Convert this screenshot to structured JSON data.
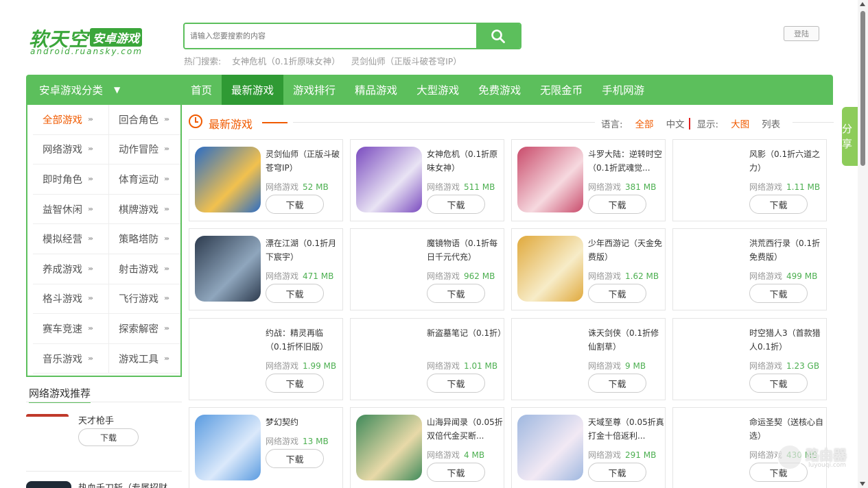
{
  "header": {
    "logo_main": "软天空",
    "logo_badge": "安卓游戏",
    "logo_sub": "android.ruansky.com",
    "search_placeholder": "请输入您要搜索的内容",
    "hot_label": "热门搜索:",
    "hot_items": [
      "女神危机（0.1折原味女神）",
      "灵剑仙师（正版斗破苍穹IP）"
    ],
    "login_label": "登陆"
  },
  "nav": {
    "category_label": "安卓游戏分类",
    "items": [
      "首页",
      "最新游戏",
      "游戏排行",
      "精品游戏",
      "大型游戏",
      "免费游戏",
      "无限金币",
      "手机网游"
    ],
    "active_index": 1
  },
  "categories": [
    "全部游戏",
    "回合角色",
    "网络游戏",
    "动作冒险",
    "即时角色",
    "体育运动",
    "益智休闲",
    "棋牌游戏",
    "模拟经营",
    "策略塔防",
    "养成游戏",
    "射击游戏",
    "格斗游戏",
    "飞行游戏",
    "赛车竞速",
    "探索解密",
    "音乐游戏",
    "游戏工具"
  ],
  "recommend": {
    "title": "网络游戏推荐",
    "items": [
      {
        "name": "天才枪手",
        "button": "下载"
      },
      {
        "name": "热血千刀斩（专属招财"
      }
    ]
  },
  "section": {
    "title": "最新游戏",
    "lang_label": "语言:",
    "lang_all": "全部",
    "lang_cn": "中文",
    "view_label": "显示:",
    "view_big": "大图",
    "view_list": "列表"
  },
  "games": [
    {
      "name": "灵剑仙师（正版斗破苍穹IP）",
      "category": "网络游戏",
      "size": "52 MB",
      "button": "下载",
      "icon": "game-icon-linjian",
      "colors": [
        "#2b6cc4",
        "#f2c14e"
      ]
    },
    {
      "name": "女神危机（0.1折原味女神）",
      "category": "网络游戏",
      "size": "511 MB",
      "button": "下载",
      "icon": "game-icon-nvshen",
      "colors": [
        "#7a4bbf",
        "#e9e4f4"
      ]
    },
    {
      "name": "斗罗大陆：逆转时空（0.1折武魂觉...",
      "category": "网络游戏",
      "size": "381 MB",
      "button": "下载",
      "icon": "game-icon-douluo",
      "colors": [
        "#c94b6b",
        "#f6d9df"
      ]
    },
    {
      "name": "风影（0.1折六道之力）",
      "category": "网络游戏",
      "size": "1.11 MB",
      "button": "下载",
      "icon": null,
      "colors": null
    },
    {
      "name": "漂在江湖（0.1折月下宸宇）",
      "category": "网络游戏",
      "size": "471 MB",
      "button": "下载",
      "icon": "game-icon-piaozai",
      "colors": [
        "#2d3b4e",
        "#8fa6bd"
      ]
    },
    {
      "name": "魔镜物语（0.1折每日千元代充）",
      "category": "网络游戏",
      "size": "962 MB",
      "button": "下载",
      "icon": null,
      "colors": null
    },
    {
      "name": "少年西游记（天金免费版）",
      "category": "网络游戏",
      "size": "1.62 MB",
      "button": "下载",
      "icon": "game-icon-xiyou",
      "colors": [
        "#e0a93c",
        "#f7ecc8"
      ]
    },
    {
      "name": "洪荒西行录（0.1折免费版）",
      "category": "网络游戏",
      "size": "499 MB",
      "button": "下载",
      "icon": null,
      "colors": null
    },
    {
      "name": "约战：精灵再临（0.1折怀旧版）",
      "category": "网络游戏",
      "size": "1.99 MB",
      "button": "下载",
      "icon": null,
      "colors": null
    },
    {
      "name": "新盗墓笔记（0.1折）",
      "category": "网络游戏",
      "size": "1.01 MB",
      "button": "下载",
      "icon": null,
      "colors": null
    },
    {
      "name": "诛天剑侠（0.1折修仙割草）",
      "category": "网络游戏",
      "size": "9 MB",
      "button": "下载",
      "icon": null,
      "colors": null
    },
    {
      "name": "时空猎人3（首款猎人0.1折）",
      "category": "网络游戏",
      "size": "1.23 GB",
      "button": "下载",
      "icon": null,
      "colors": null
    },
    {
      "name": "梦幻契约",
      "category": "网络游戏",
      "size": "13 MB",
      "button": "下载",
      "icon": "game-icon-menghuan",
      "colors": [
        "#5a9be0",
        "#dbe9fb"
      ]
    },
    {
      "name": "山海异闻录（0.05折双倍代金买断...",
      "category": "网络游戏",
      "size": "4 MB",
      "button": "下载",
      "icon": "game-icon-shanhai",
      "colors": [
        "#3f8a5a",
        "#e8d9a8"
      ]
    },
    {
      "name": "天域至尊（0.05折真打金十倍返利...",
      "category": "网络游戏",
      "size": "291 MB",
      "button": "下载",
      "icon": "game-icon-tianyu",
      "colors": [
        "#9fb8e0",
        "#f2e9f4"
      ]
    },
    {
      "name": "命运圣契（送核心自选）",
      "category": "网络游戏",
      "size": "430 MB",
      "button": "下载",
      "icon": null,
      "colors": null
    }
  ],
  "share_label": "分享",
  "watermark": {
    "text": "路由器",
    "sub": "luyouqi.com"
  }
}
